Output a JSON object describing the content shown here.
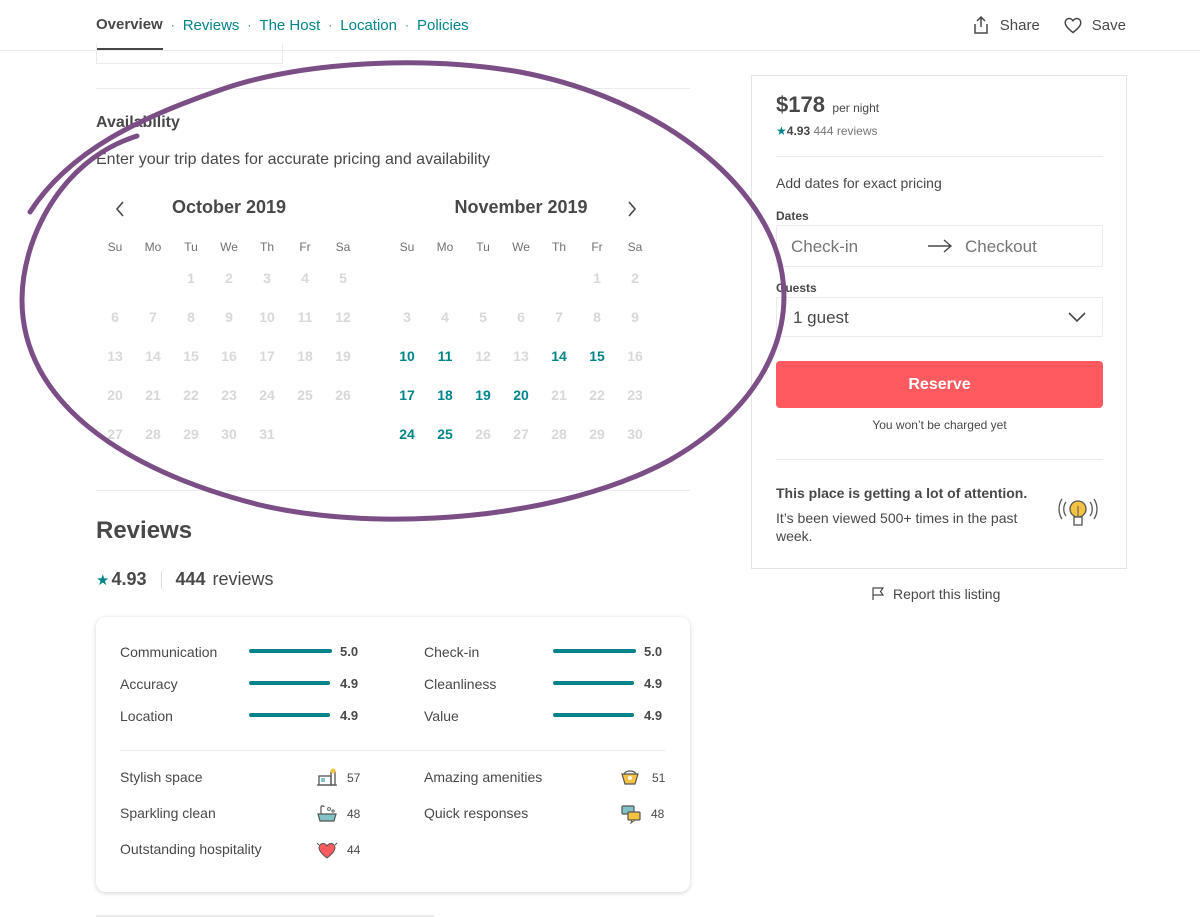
{
  "nav": {
    "tabs": [
      {
        "label": "Overview",
        "active": true
      },
      {
        "label": "Reviews"
      },
      {
        "label": "The Host"
      },
      {
        "label": "Location"
      },
      {
        "label": "Policies"
      }
    ],
    "separator": "·",
    "share_label": "Share",
    "save_label": "Save",
    "share_icon": "share-icon",
    "save_icon": "heart-icon"
  },
  "availability": {
    "title": "Availability",
    "subtitle": "Enter your trip dates for accurate pricing and availability",
    "weekday_labels": [
      "Su",
      "Mo",
      "Tu",
      "We",
      "Th",
      "Fr",
      "Sa"
    ],
    "months": [
      {
        "title": "October 2019",
        "weeks": [
          [
            "",
            "",
            "1",
            "2",
            "3",
            "4",
            "5"
          ],
          [
            "6",
            "7",
            "8",
            "9",
            "10",
            "11",
            "12"
          ],
          [
            "13",
            "14",
            "15",
            "16",
            "17",
            "18",
            "19"
          ],
          [
            "20",
            "21",
            "22",
            "23",
            "24",
            "25",
            "26"
          ],
          [
            "27",
            "28",
            "29",
            "30",
            "31",
            "",
            ""
          ]
        ],
        "available_days": []
      },
      {
        "title": "November 2019",
        "weeks": [
          [
            "",
            "",
            "",
            "",
            "",
            "1",
            "2"
          ],
          [
            "3",
            "4",
            "5",
            "6",
            "7",
            "8",
            "9"
          ],
          [
            "10",
            "11",
            "12",
            "13",
            "14",
            "15",
            "16"
          ],
          [
            "17",
            "18",
            "19",
            "20",
            "21",
            "22",
            "23"
          ],
          [
            "24",
            "25",
            "26",
            "27",
            "28",
            "29",
            "30"
          ]
        ],
        "available_days": [
          "10",
          "11",
          "14",
          "15",
          "17",
          "18",
          "19",
          "20",
          "24",
          "25"
        ]
      }
    ]
  },
  "reviews": {
    "title": "Reviews",
    "star": "★",
    "rating": "4.93",
    "count": "444",
    "count_label": "reviews",
    "categories": [
      {
        "label": "Communication",
        "score": "5.0",
        "value": 5.0
      },
      {
        "label": "Check-in",
        "score": "5.0",
        "value": 5.0
      },
      {
        "label": "Accuracy",
        "score": "4.9",
        "value": 4.9
      },
      {
        "label": "Cleanliness",
        "score": "4.9",
        "value": 4.9
      },
      {
        "label": "Location",
        "score": "4.9",
        "value": 4.9
      },
      {
        "label": "Value",
        "score": "4.9",
        "value": 4.9
      }
    ],
    "highlights": [
      {
        "label": "Stylish space",
        "count": "57",
        "icon": "stylish-space-icon"
      },
      {
        "label": "Amazing amenities",
        "count": "51",
        "icon": "amenities-icon"
      },
      {
        "label": "Sparkling clean",
        "count": "48",
        "icon": "bathtub-icon"
      },
      {
        "label": "Quick responses",
        "count": "48",
        "icon": "chat-bubbles-icon"
      },
      {
        "label": "Outstanding hospitality",
        "count": "44",
        "icon": "heart-icon"
      }
    ]
  },
  "booking": {
    "price": "$178",
    "per_night": "per night",
    "star": "★",
    "rating": "4.93",
    "reviews_text": "444 reviews",
    "add_dates": "Add dates for exact pricing",
    "dates_label": "Dates",
    "checkin_placeholder": "Check-in",
    "checkout_placeholder": "Checkout",
    "guests_label": "Guests",
    "guests_value": "1 guest",
    "reserve_label": "Reserve",
    "charge_note": "You won’t be charged yet",
    "attention_title": "This place is getting a lot of attention.",
    "attention_text": "It’s been viewed 500+ times in the past week.",
    "attention_icon": "lightbulb-icon"
  },
  "report_label": "Report this listing",
  "colors": {
    "teal": "#008489",
    "text": "#484848",
    "disabled_day": "#d8d8d8",
    "reserve": "#ff5a5f",
    "scribble": "#7b4f86"
  }
}
